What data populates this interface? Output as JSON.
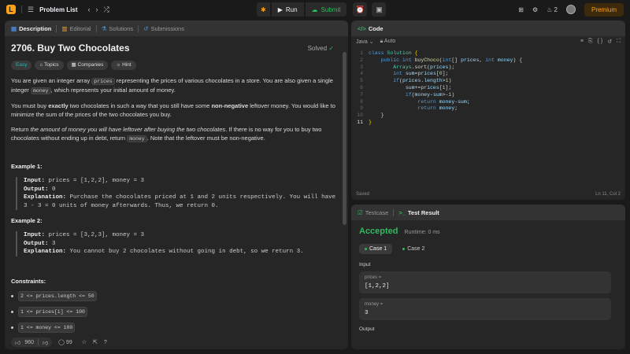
{
  "topbar": {
    "problem_list": "Problem List",
    "run": "Run",
    "submit": "Submit",
    "streak": "2",
    "premium": "Premium"
  },
  "desc_tabs": [
    "Description",
    "Editorial",
    "Solutions",
    "Submissions"
  ],
  "problem": {
    "title": "2706. Buy Two Chocolates",
    "solved": "Solved",
    "chips": [
      "Easy",
      "Topics",
      "Companies",
      "Hint"
    ],
    "p1a": "You are given an integer array ",
    "p1code": "prices",
    "p1b": " representing the prices of various chocolates in a store. You are also given a single integer ",
    "p1code2": "money",
    "p1c": ", which represents your initial amount of money.",
    "p2a": "You must buy ",
    "p2b": "exactly",
    "p2c": " two chocolates in such a way that you still have some ",
    "p2d": "non-negative",
    "p2e": " leftover money. You would like to minimize the sum of the prices of the two chocolates you buy.",
    "p3a": "Return ",
    "p3b": "the amount of money you will have leftover after buying the two chocolates",
    "p3c": ". If there is no way for you to buy two chocolates without ending up in debt, return ",
    "p3code": "money",
    "p3d": ". Note that the leftover must be non-negative.",
    "ex1_title": "Example 1:",
    "ex1_input": "prices = [1,2,2], money = 3",
    "ex1_output": "0",
    "ex1_expl": "Purchase the chocolates priced at 1 and 2 units respectively. You will have 3 - 3 = 0 units of money afterwards. Thus, we return 0.",
    "ex2_title": "Example 2:",
    "ex2_input": "prices = [3,2,3], money = 3",
    "ex2_output": "3",
    "ex2_expl": "You cannot buy 2 chocolates without going in debt, so we return 3.",
    "input_label": "Input:",
    "output_label": "Output:",
    "expl_label": "Explanation:",
    "constraints_title": "Constraints:",
    "constraints": [
      "2 <= prices.length <= 50",
      "1 <= prices[i] <= 100",
      "1 <= money <= 100"
    ]
  },
  "bottom": {
    "likes": "960",
    "comments": "99"
  },
  "code_panel": {
    "title": "Code",
    "language": "Java",
    "mode": "Auto",
    "status": "Saved",
    "cursor": "Ln 11, Col 2"
  },
  "test_panel": {
    "tab1": "Testcase",
    "tab2": "Test Result",
    "result": "Accepted",
    "runtime": "Runtime: 0 ms",
    "case1": "Case 1",
    "case2": "Case 2",
    "input_label": "Input",
    "output_label": "Output",
    "var1_name": "prices =",
    "var1_val": "[1,2,2]",
    "var2_name": "money =",
    "var2_val": "3"
  }
}
